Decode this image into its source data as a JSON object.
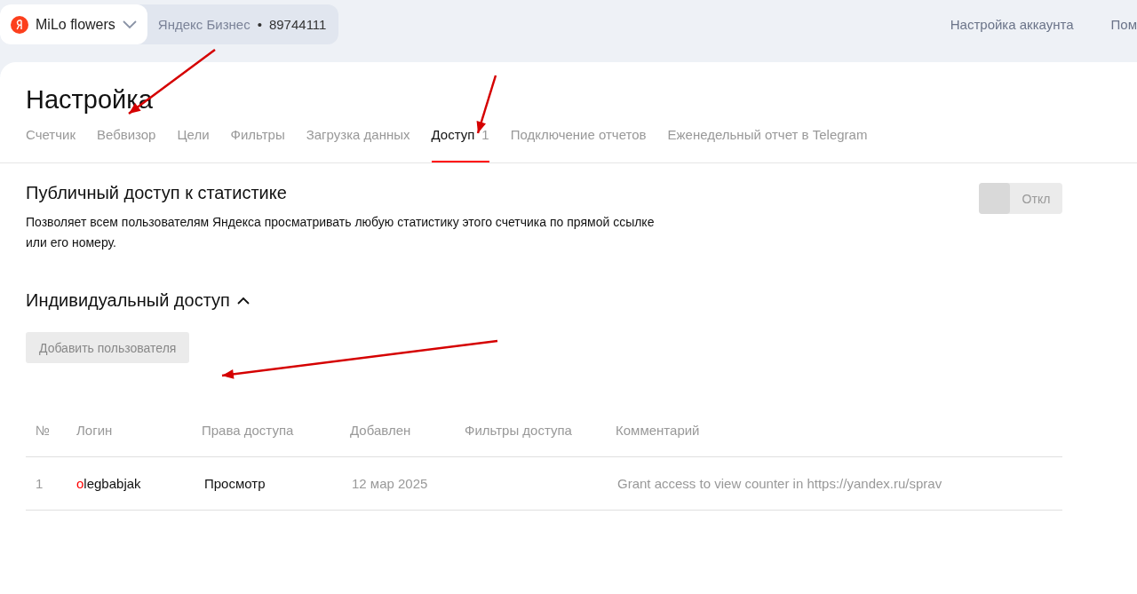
{
  "header": {
    "counter_name": "MiLo flowers",
    "source": "Яндекс Бизнес",
    "separator": "•",
    "counter_id": "89744111",
    "links": [
      "Настройка аккаунта",
      "Пом"
    ]
  },
  "page": {
    "title": "Настройка"
  },
  "tabs": [
    {
      "label": "Счетчик",
      "selected": false
    },
    {
      "label": "Вебвизор",
      "selected": false
    },
    {
      "label": "Цели",
      "selected": false
    },
    {
      "label": "Фильтры",
      "selected": false
    },
    {
      "label": "Загрузка данных",
      "selected": false
    },
    {
      "label": "Доступ",
      "count": "1",
      "selected": true
    },
    {
      "label": "Подключение отчетов",
      "selected": false
    },
    {
      "label": "Еженедельный отчет в Telegram",
      "selected": false
    }
  ],
  "public_access": {
    "title": "Публичный доступ к статистике",
    "description": "Позволяет всем пользователям Яндекса просматривать любую статистику этого счетчика по прямой ссылке или его номеру.",
    "toggle": {
      "label": "Откл",
      "on": false
    }
  },
  "individual_access": {
    "title": "Индивидуальный доступ",
    "expanded": true,
    "add_button": "Добавить пользователя",
    "table": {
      "columns": [
        "№",
        "Логин",
        "Права доступа",
        "Добавлен",
        "Фильтры доступа",
        "Комментарий"
      ],
      "rows": [
        {
          "number": "1",
          "login": "olegbabjak",
          "rights": "Просмотр",
          "added": "12 мар 2025",
          "comment": "Grant access to view counter in https://yandex.ru/sprav"
        }
      ]
    }
  }
}
